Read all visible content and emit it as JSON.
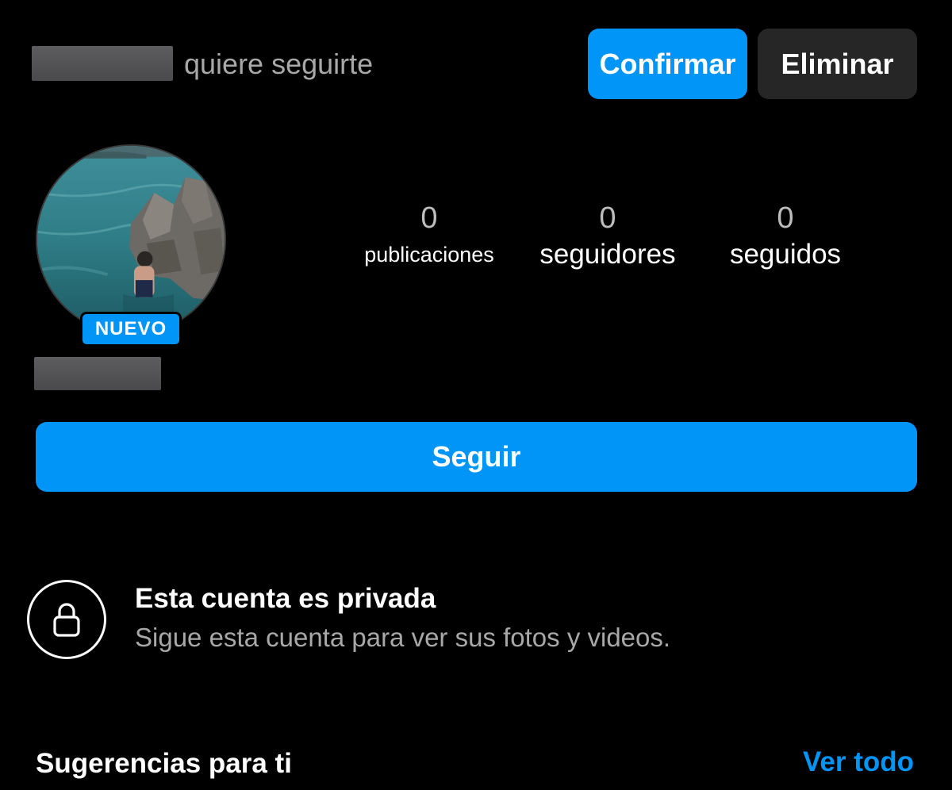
{
  "follow_request": {
    "text": "quiere seguirte",
    "confirm_label": "Confirmar",
    "remove_label": "Eliminar"
  },
  "profile": {
    "badge": "NUEVO",
    "stats": {
      "posts_count": "0",
      "posts_label": "publicaciones",
      "followers_count": "0",
      "followers_label": "seguidores",
      "following_count": "0",
      "following_label": "seguidos"
    },
    "follow_label": "Seguir"
  },
  "private_notice": {
    "title": "Esta cuenta es privada",
    "subtitle": "Sigue esta cuenta para ver sus fotos y videos.",
    "icon": "lock-icon"
  },
  "suggestions": {
    "title": "Sugerencias para ti",
    "see_all_label": "Ver todo"
  },
  "colors": {
    "background": "#000000",
    "accent": "#0095f6",
    "secondary_button": "#262626",
    "muted_text": "#a8a8a8"
  }
}
